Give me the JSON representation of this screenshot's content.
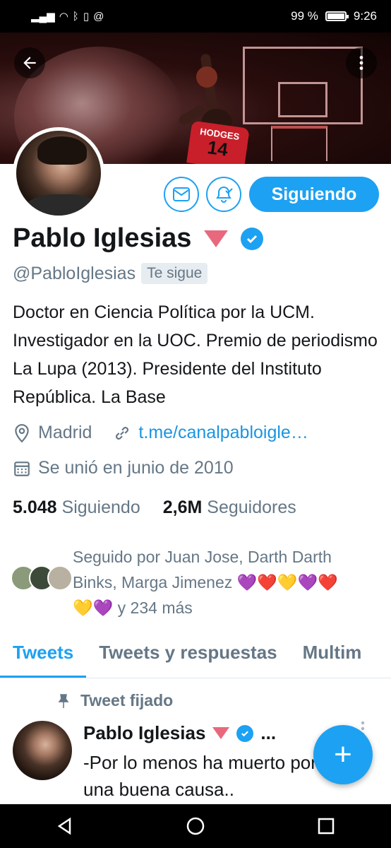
{
  "status_bar": {
    "left_icons": [
      "signal-icon",
      "wifi-icon",
      "bluetooth-icon",
      "vibrate-icon",
      "at-icon"
    ],
    "battery": "99 %",
    "time": "9:26"
  },
  "header": {
    "back_icon": "arrow-left-icon",
    "overflow_icon": "more-vertical-icon",
    "banner_jersey_name": "HODGES",
    "banner_jersey_number": "14"
  },
  "actions": {
    "message_icon": "envelope-icon",
    "notify_icon": "bell-check-icon",
    "follow_label": "Siguiendo"
  },
  "profile": {
    "name": "Pablo Iglesias",
    "handle": "@PabloIglesias",
    "follows_you": "Te sigue",
    "bio": "Doctor en Ciencia Política por la UCM. Investigador en la UOC. Premio de periodismo La Lupa (2013). Presidente del Instituto República. La Base",
    "location": "Madrid",
    "link": "t.me/canalpabloigle…",
    "joined": "Se unió en junio de 2010",
    "following_count": "5.048",
    "following_label": "Siguiendo",
    "followers_count": "2,6M",
    "followers_label": "Seguidores"
  },
  "followed_by": {
    "line1": "Seguido por Juan Jose, Darth Darth",
    "line2": "Binks, Marga Jimenez 💜❤️💛💜❤️",
    "line3": "💛💜 y 234 más"
  },
  "tabs": [
    {
      "label": "Tweets",
      "active": true
    },
    {
      "label": "Tweets y respuestas",
      "active": false
    },
    {
      "label": "Multim",
      "active": false
    }
  ],
  "pinned_tweet": {
    "pinned_label": "Tweet fijado",
    "author": "Pablo Iglesias",
    "more": "...",
    "text": "-Por lo menos ha muerto por una buena causa.."
  },
  "fab_label": "+",
  "colors": {
    "accent": "#1da1f2",
    "secondary_text": "#657786",
    "party_triangle": "#e8697d"
  }
}
